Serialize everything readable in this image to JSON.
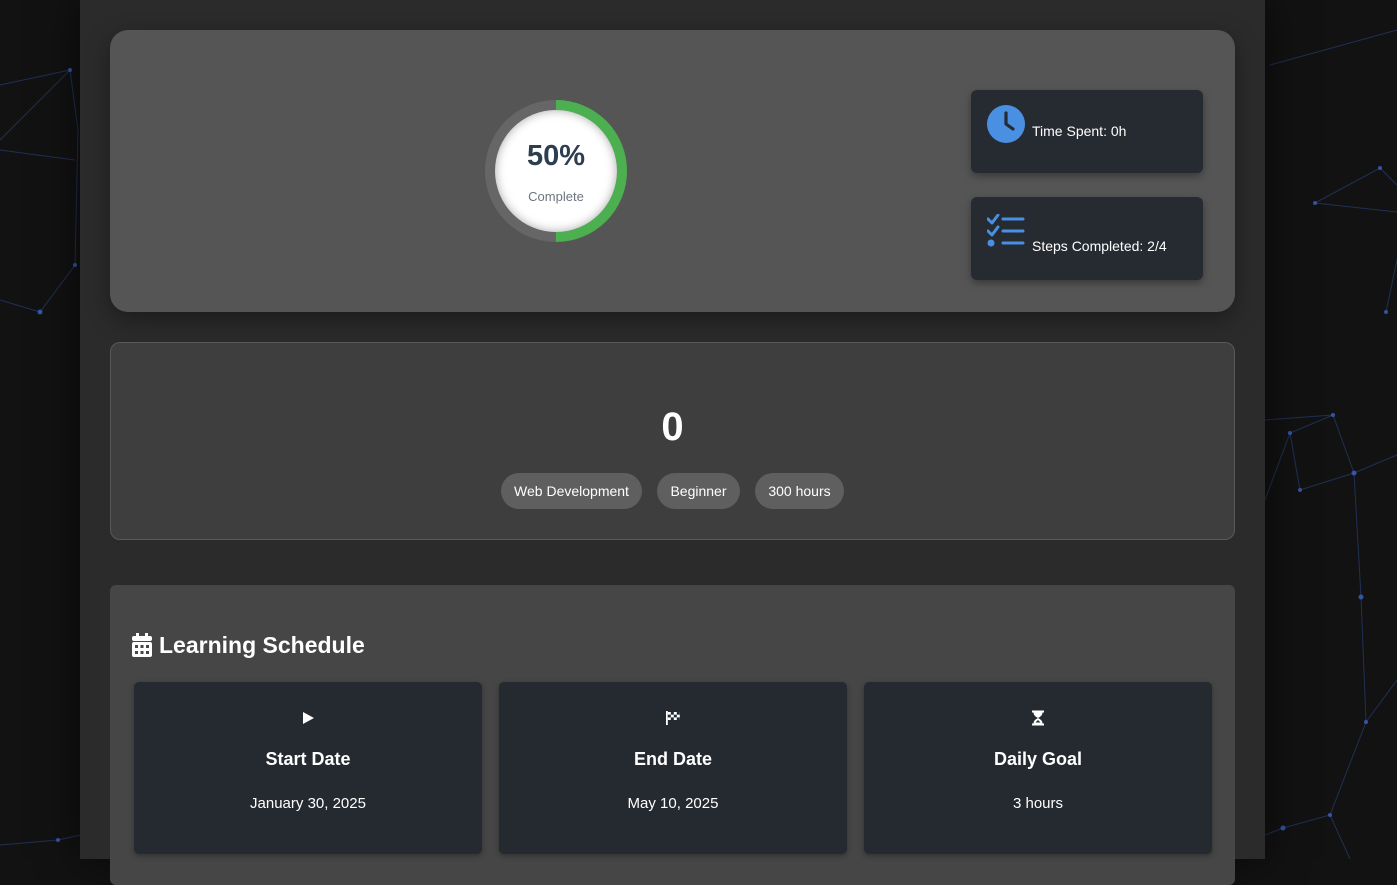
{
  "progress": {
    "percent": 50,
    "percent_label": "50%",
    "caption": "Complete",
    "ring_color": "#4caf50",
    "track_color": "#666666"
  },
  "stats": {
    "time_spent": {
      "icon": "clock-icon",
      "label": "Time Spent: 0h"
    },
    "steps_completed": {
      "icon": "checklist-icon",
      "label": "Steps Completed: 2/4"
    },
    "icon_color": "#4a90e2"
  },
  "roadmap": {
    "number": "0",
    "tags": [
      "Web Development",
      "Beginner",
      "300 hours"
    ]
  },
  "schedule": {
    "title": "Learning Schedule",
    "title_icon": "calendar-icon",
    "items": [
      {
        "icon": "play-icon",
        "label": "Start Date",
        "value": "January 30, 2025"
      },
      {
        "icon": "checkered-flag-icon",
        "label": "End Date",
        "value": "May 10, 2025"
      },
      {
        "icon": "hourglass-icon",
        "label": "Daily Goal",
        "value": "3 hours"
      }
    ]
  }
}
